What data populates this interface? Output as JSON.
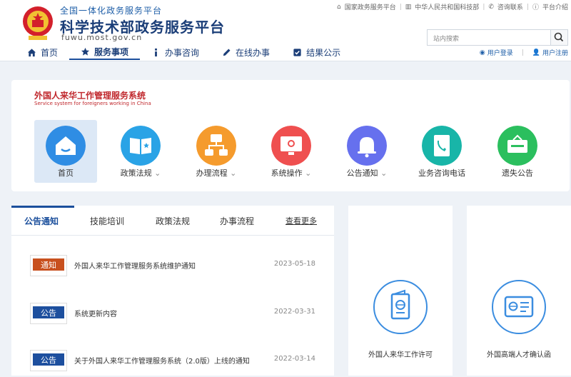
{
  "header": {
    "portal": "全国一体化政务服务平台",
    "title": "科学技术部政务服务平台",
    "url": "fuwu.most.gov.cn",
    "toplinks": [
      "国家政务服务平台",
      "中华人民共和国科技部",
      "咨询联系",
      "平台介绍"
    ],
    "search_placeholder": "站内搜索",
    "nav": [
      "首页",
      "服务事项",
      "办事咨询",
      "在线办事",
      "结果公示"
    ],
    "login": "用户登录",
    "register": "用户注册"
  },
  "system": {
    "title": "外国人来华工作管理服务系统",
    "subtitle": "Service system for foreigners working in China",
    "items": [
      {
        "label": "首页",
        "color": "#2f8de4"
      },
      {
        "label": "政策法规",
        "color": "#2aa3e6"
      },
      {
        "label": "办理流程",
        "color": "#f59b2d"
      },
      {
        "label": "系统操作",
        "color": "#ef4f4f"
      },
      {
        "label": "公告通知",
        "color": "#6670ee"
      },
      {
        "label": "业务咨询电话",
        "color": "#18b5a8"
      },
      {
        "label": "遗失公告",
        "color": "#2bbf5e"
      }
    ]
  },
  "news": {
    "tabs": [
      "公告通知",
      "技能培训",
      "政策法规",
      "办事流程"
    ],
    "more": "查看更多",
    "items": [
      {
        "badge": "通知",
        "title": "外国人来华工作管理服务系统维护通知",
        "date": "2023-05-18"
      },
      {
        "badge": "公告",
        "title": "系统更新内容",
        "date": "2022-03-31"
      },
      {
        "badge": "公告",
        "title": "关于外国人来华工作管理服务系统（2.0版）上线的通知",
        "date": "2022-03-14"
      }
    ]
  },
  "cards": [
    "外国人来华工作许可",
    "外国高端人才确认函"
  ]
}
